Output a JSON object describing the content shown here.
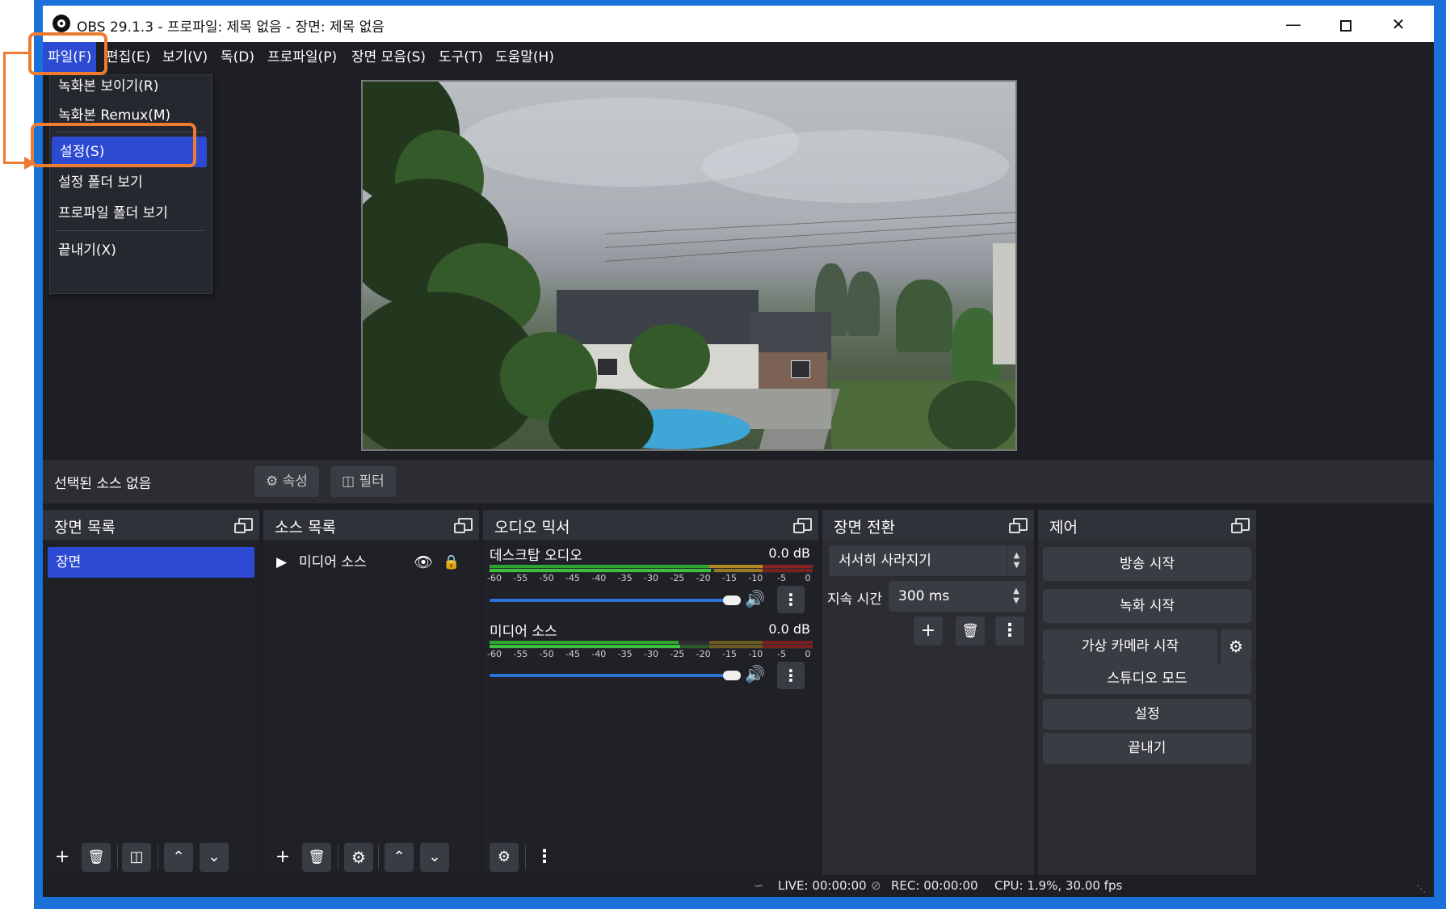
{
  "window": {
    "title": "OBS 29.1.3 - 프로파일: 제목 없음 - 장면: 제목 없음"
  },
  "menubar": {
    "items": [
      "파일(F)",
      "편집(E)",
      "보기(V)",
      "독(D)",
      "프로파일(P)",
      "장면 모음(S)",
      "도구(T)",
      "도움말(H)"
    ]
  },
  "file_menu": {
    "items": [
      "녹화본 보이기(R)",
      "녹화본 Remux(M)",
      "설정(S)",
      "설정 폴더 보기",
      "프로파일 폴더 보기",
      "끝내기(X)"
    ]
  },
  "properties_bar": {
    "label": "선택된 소스 없음",
    "properties": "속성",
    "filters": "필터"
  },
  "scenes": {
    "title": "장면 목록",
    "items": [
      "장면"
    ]
  },
  "sources": {
    "title": "소스 목록",
    "items": [
      "미디어 소스"
    ]
  },
  "mixer": {
    "title": "오디오 믹서",
    "ticks": [
      "-60",
      "-55",
      "-50",
      "-45",
      "-40",
      "-35",
      "-30",
      "-25",
      "-20",
      "-15",
      "-10",
      "-5",
      "0"
    ],
    "channels": [
      {
        "name": "데스크탑 오디오",
        "db": "0.0 dB",
        "volume": 1.0
      },
      {
        "name": "미디어 소스",
        "db": "0.0 dB",
        "volume": 1.0
      }
    ]
  },
  "transitions": {
    "title": "장면 전환",
    "selected": "서서히 사라지기",
    "duration_label": "지속 시간",
    "duration_value": "300 ms"
  },
  "controls": {
    "title": "제어",
    "start_streaming": "방송 시작",
    "start_recording": "녹화 시작",
    "start_virtual_camera": "가상 카메라 시작",
    "studio_mode": "스튜디오 모드",
    "settings": "설정",
    "exit": "끝내기"
  },
  "status": {
    "live": "LIVE: 00:00:00",
    "rec": "REC: 00:00:00",
    "cpu": "CPU: 1.9%, 30.00 fps"
  },
  "colors": {
    "accent": "#2c4bd2",
    "annotation": "#ee7b30",
    "dock_bg": "#2b2d33"
  }
}
